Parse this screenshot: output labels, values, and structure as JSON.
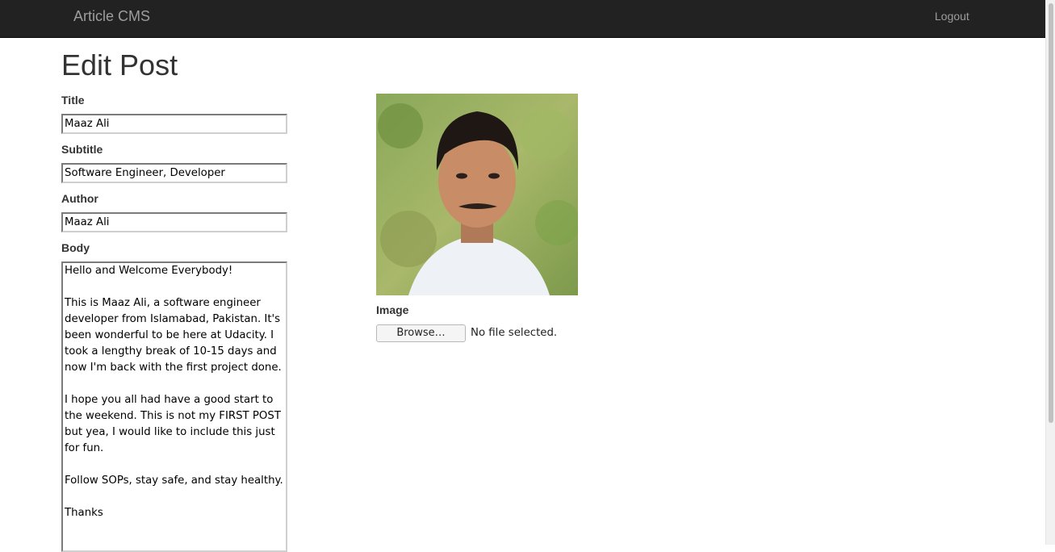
{
  "navbar": {
    "brand": "Article CMS",
    "logout_label": "Logout",
    "background": "#222222",
    "link_color": "#9d9d9d"
  },
  "page": {
    "heading": "Edit Post"
  },
  "form": {
    "title": {
      "label": "Title",
      "value": "Maaz Ali"
    },
    "subtitle": {
      "label": "Subtitle",
      "value": "Software Engineer, Developer"
    },
    "author": {
      "label": "Author",
      "value": "Maaz Ali"
    },
    "body": {
      "label": "Body",
      "value": "Hello and Welcome Everybody!\n\nThis is Maaz Ali, a software engineer developer from Islamabad, Pakistan. It's been wonderful to be here at Udacity. I took a lengthy break of 10-15 days and now I'm back with the first project done.\n\nI hope you all had have a good start to the weekend. This is not my FIRST POST but yea, I would like to include this just for fun.\n\nFollow SOPs, stay safe, and stay healthy.\n\nThanks"
    }
  },
  "image": {
    "label": "Image",
    "browse_label": "Browse…",
    "file_status": "No file selected.",
    "preview_icon": "portrait-photo"
  }
}
